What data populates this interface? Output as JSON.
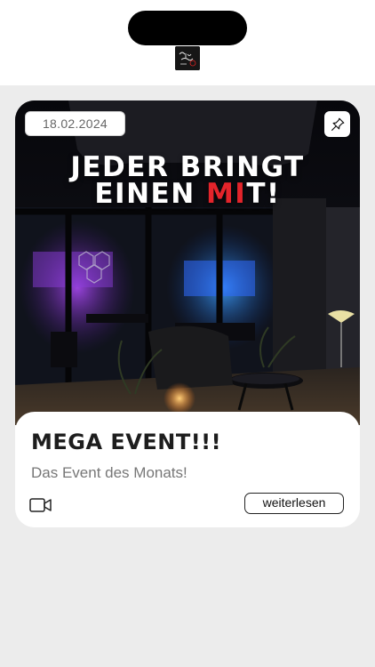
{
  "header": {
    "logo_icon": "play-your-life-logo"
  },
  "event_card": {
    "date": "18.02.2024",
    "pin_icon": "pin-icon",
    "headline_line1": "JEDER BRINGT",
    "headline_line2_a": "EINEN ",
    "headline_line2_accent": "MI",
    "headline_line2_b": "T!",
    "title": "MEGA EVENT!!!",
    "subtitle": "Das Event des Monats!",
    "media_icon": "video-camera-icon",
    "read_more_label": "weiterlesen",
    "accent_color": "#e3242b"
  }
}
